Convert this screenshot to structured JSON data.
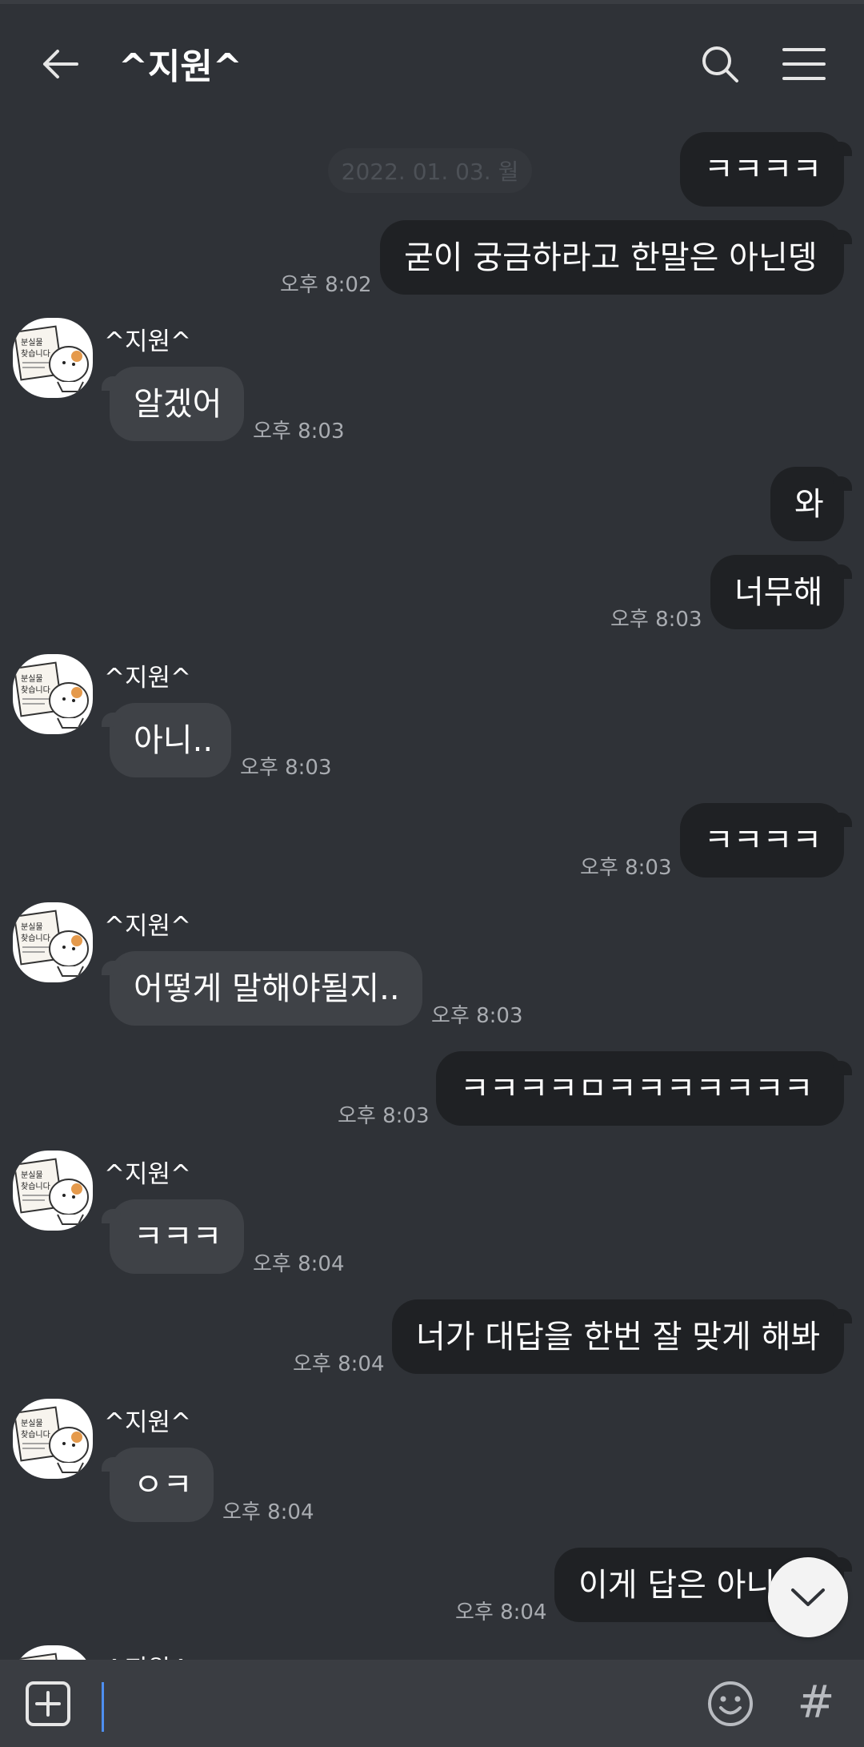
{
  "header": {
    "title": "^지원^"
  },
  "date_separator": "2022. 01. 03. 월",
  "messages": [
    {
      "text": "ㅋㅋㅋㅋ"
    },
    {
      "text": "굳이 궁금하라고 한말은 아닌뎅",
      "time": "오후 8:02"
    },
    {
      "sender": "^지원^",
      "text": "알겠어",
      "time": "오후 8:03"
    },
    {
      "text": "와"
    },
    {
      "text": "너무해",
      "time": "오후 8:03"
    },
    {
      "sender": "^지원^",
      "text": "아니..",
      "time": "오후 8:03"
    },
    {
      "text": "ㅋㅋㅋㅋ",
      "time": "오후 8:03"
    },
    {
      "sender": "^지원^",
      "text": "어떻게 말해야될지..",
      "time": "오후 8:03"
    },
    {
      "text": "ㅋㅋㅋㅋㅁㅋㅋㅋㅋㅋㅋㅋ",
      "time": "오후 8:03"
    },
    {
      "sender": "^지원^",
      "text": "ㅋㅋㅋ",
      "time": "오후 8:04"
    },
    {
      "text": "너가 대답을 한번 잘 맞게 해봐",
      "time": "오후 8:04"
    },
    {
      "sender": "^지원^",
      "text": "ㅇㅋ",
      "time": "오후 8:04"
    },
    {
      "text": "이게 답은 아니지?",
      "time": "오후 8:04"
    },
    {
      "sender": "^지원^"
    }
  ],
  "avatar_sign": {
    "line1": "분실물",
    "line2": "찾습니다"
  },
  "colors": {
    "background": "#2f3237",
    "my_bubble": "#1f2124",
    "their_bubble": "#3f4247",
    "caret": "#4e8ff0"
  },
  "icons": {
    "back": "arrow-left-icon",
    "search": "search-icon",
    "menu": "hamburger-icon",
    "scroll": "chevron-down-icon",
    "plus": "plus-square-icon",
    "emoji": "smiley-icon",
    "hash": "#"
  }
}
